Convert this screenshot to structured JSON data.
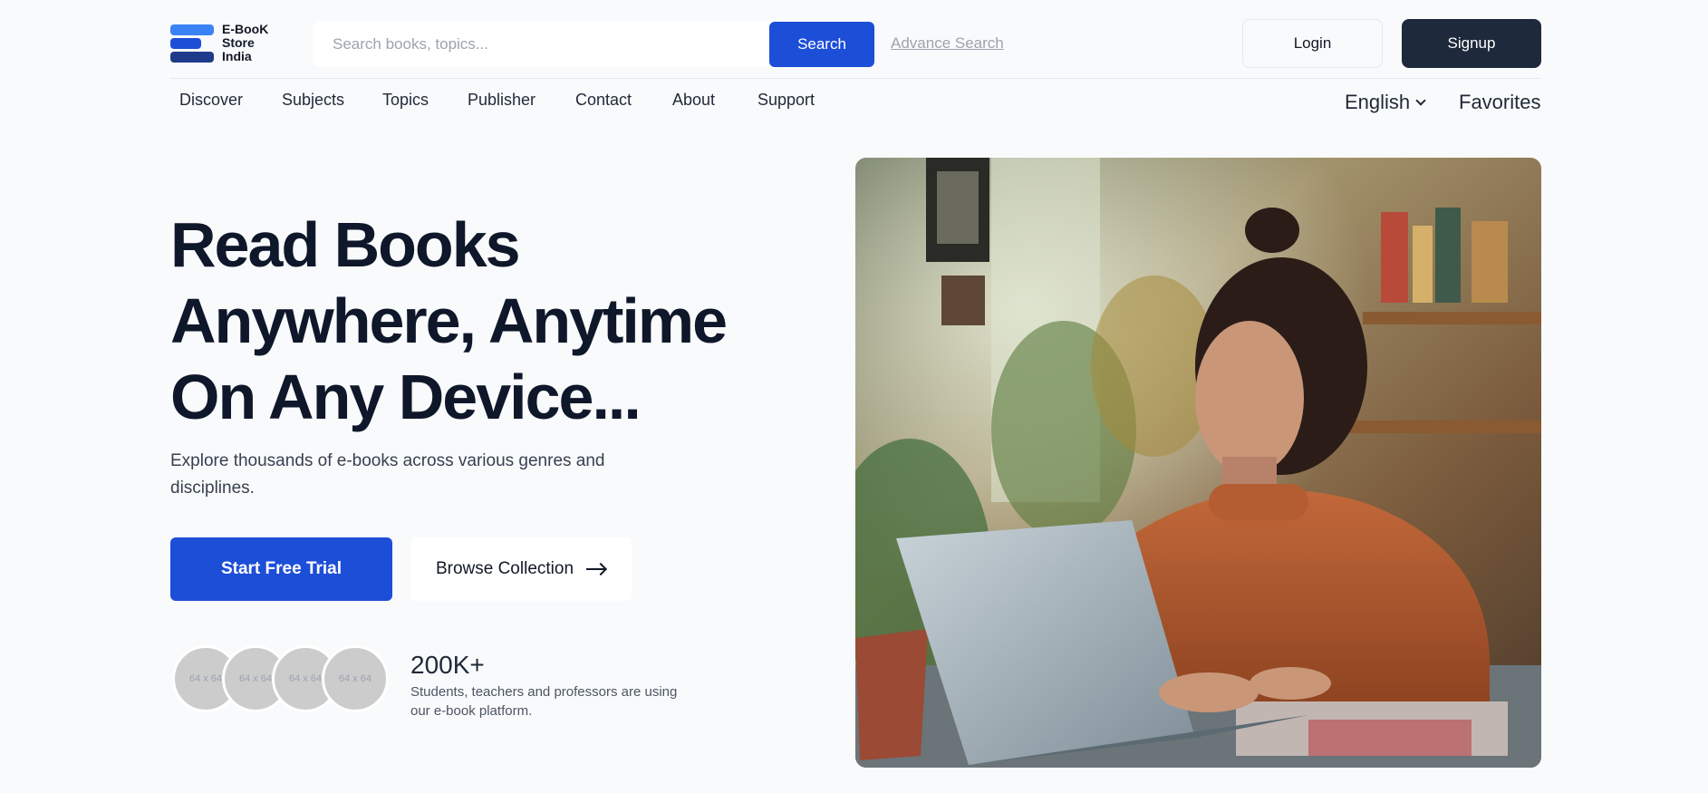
{
  "brand": {
    "logo_lines": [
      "E-BooK",
      "Store",
      "India"
    ]
  },
  "search": {
    "placeholder": "Search books, topics...",
    "button_label": "Search",
    "advance_label": "Advance Search"
  },
  "auth": {
    "login_label": "Login",
    "signup_label": "Signup"
  },
  "nav": {
    "items": [
      {
        "label": "Discover"
      },
      {
        "label": "Subjects"
      },
      {
        "label": "Topics"
      },
      {
        "label": "Publisher"
      },
      {
        "label": "Contact"
      },
      {
        "label": "About"
      },
      {
        "label": "Support"
      }
    ],
    "language": "English",
    "favorites": "Favorites"
  },
  "hero": {
    "title_lines": [
      "Read Books",
      "Anywhere, Anytime",
      "On Any Device..."
    ],
    "subtitle": "Explore thousands of e-books across various genres and disciplines.",
    "primary_cta": "Start Free Trial",
    "secondary_cta": "Browse Collection"
  },
  "stats": {
    "avatar_placeholders": [
      "64 x 64",
      "64 x 64",
      "64 x 64",
      "64 x 64"
    ],
    "count": "200K+",
    "description": "Students, teachers and professors are using our e-book platform."
  },
  "colors": {
    "primary": "#1d4ed8",
    "dark": "#1e293b",
    "background": "#f9fafb",
    "muted": "#9ca3af"
  }
}
